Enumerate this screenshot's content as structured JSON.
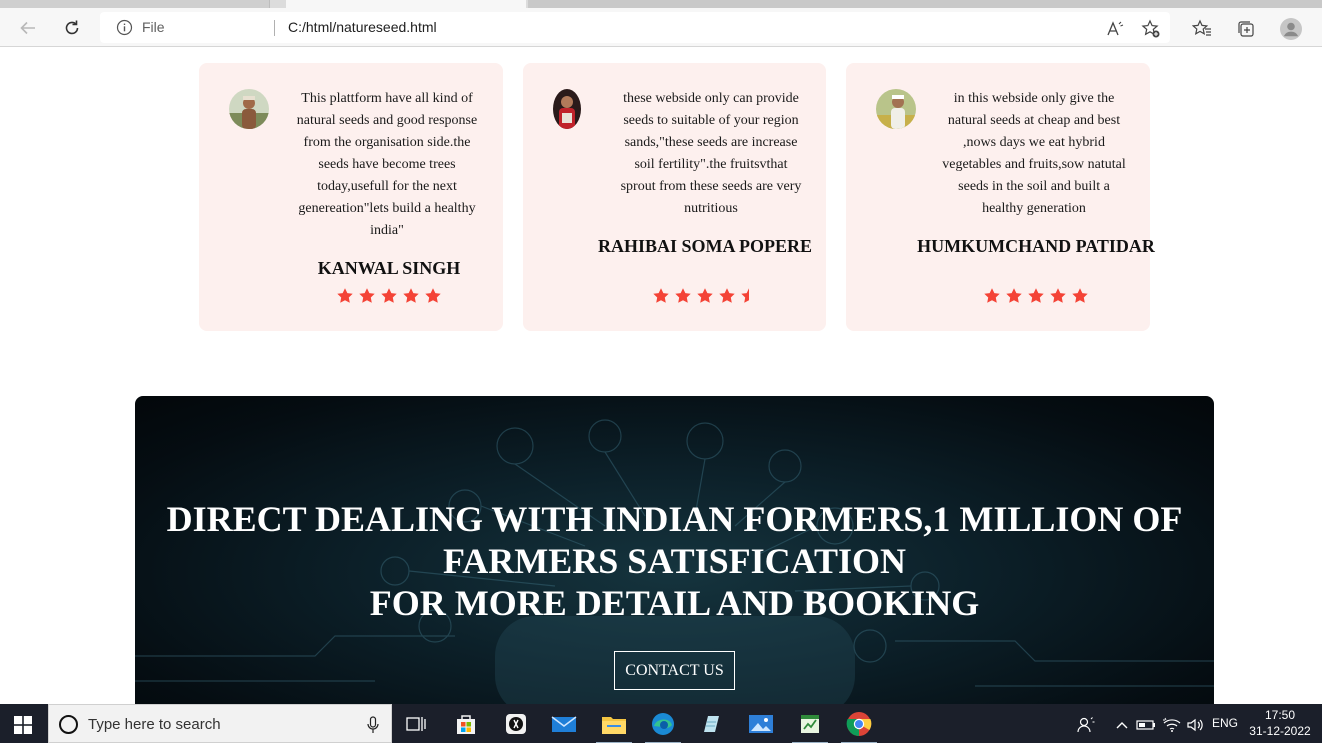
{
  "browser": {
    "address": {
      "scheme_label": "File",
      "url": "C:/html/natureseed.html"
    },
    "icons": [
      "back-arrow-icon",
      "reload-icon",
      "info-icon",
      "read-aloud-icon",
      "add-favorite-icon",
      "favorites-icon",
      "collections-icon",
      "profile-icon"
    ]
  },
  "testimonials": [
    {
      "text": "This plattform have all kind of natural seeds and good response from the organisation side.the seeds have become trees today,usefull for the next genereation\"lets build a healthy india\"",
      "name": "KANWAL SINGH",
      "rating": 5
    },
    {
      "text": "these webside only can provide seeds to suitable of your region sands,\"these seeds are increase soil fertility\".the fruitsvthat sprout from these seeds are very nutritious",
      "name": "RAHIBAI SOMA POPERE",
      "rating": 4.5
    },
    {
      "text": "in this webside only give the natural seeds at cheap and best ,nows days we eat hybrid vegetables and fruits,sow natutal seeds in the soil and built a healthy generation",
      "name": "HUMKUMCHAND PATIDAR",
      "rating": 5
    }
  ],
  "banner": {
    "line1": "DIRECT DEALING WITH INDIAN FORMERS,1 MILLION OF FARMERS SATISFICATION",
    "line2": "FOR MORE DETAIL AND BOOKING",
    "button": "CONTACT US"
  },
  "taskbar": {
    "search_placeholder": "Type here to search",
    "language": "ENG",
    "time": "17:50",
    "date": "31-12-2022",
    "apps": [
      "task-view-icon",
      "store-icon",
      "epic-icon",
      "mail-icon",
      "file-explorer-icon",
      "edge-icon",
      "notepad-icon",
      "photos-icon",
      "spreadsheet-icon",
      "chrome-icon"
    ]
  },
  "colors": {
    "card_bg": "#fdf0ee",
    "star": "#f44336",
    "banner_text": "#ffffff"
  }
}
